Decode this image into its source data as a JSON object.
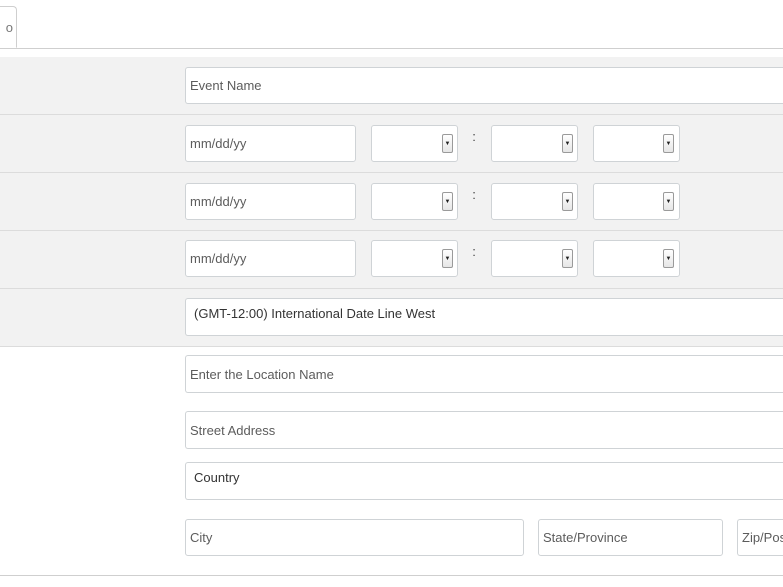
{
  "tab": {
    "label": "o"
  },
  "event_name": {
    "placeholder": "Event Name"
  },
  "date_rows": [
    {
      "date_placeholder": "mm/dd/yy",
      "colon": ":"
    },
    {
      "date_placeholder": "mm/dd/yy",
      "colon": ":"
    },
    {
      "date_placeholder": "mm/dd/yy",
      "colon": ":"
    }
  ],
  "select_arrow_glyph": "▼",
  "timezone": {
    "value": "(GMT-12:00) International Date Line West"
  },
  "location": {
    "name_placeholder": "Enter the Location Name",
    "street_placeholder": "Street Address",
    "country_value": "Country",
    "city_placeholder": "City",
    "state_placeholder": "State/Province",
    "zip_placeholder": "Zip/Pos"
  },
  "colors": {
    "row_gray": "#f2f2f2",
    "border": "#cfd3d6",
    "divider": "#dcdcdc"
  }
}
